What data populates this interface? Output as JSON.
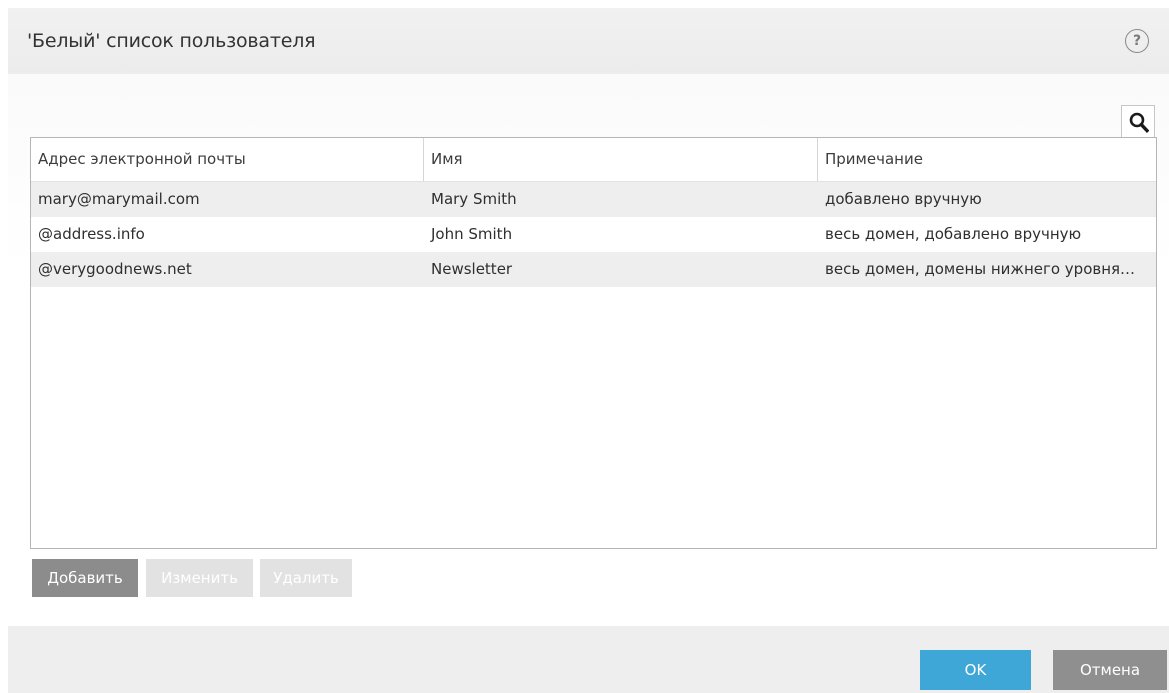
{
  "dialog": {
    "title": "'Белый' список пользователя",
    "help_label": "?"
  },
  "icons": {
    "help": "question-circle-icon",
    "search": "search-icon"
  },
  "table": {
    "columns": [
      "Адрес электронной почты",
      "Имя",
      "Примечание"
    ],
    "rows": [
      {
        "email": "mary@marymail.com",
        "name": "Mary Smith",
        "note": "добавлено вручную"
      },
      {
        "email": "@address.info",
        "name": "John Smith",
        "note": "весь домен, добавлено вручную"
      },
      {
        "email": "@verygoodnews.net",
        "name": "Newsletter",
        "note": "весь домен, домены нижнего уровня…"
      }
    ]
  },
  "actions": {
    "add_label": "Добавить",
    "edit_label": "Изменить",
    "delete_label": "Удалить"
  },
  "footer": {
    "ok_label": "OK",
    "cancel_label": "Отмена"
  },
  "colors": {
    "accent": "#3fa7d7",
    "button_gray": "#8c8c8c",
    "button_disabled": "#e2e2e2",
    "row_stripe": "#eeeeee"
  }
}
